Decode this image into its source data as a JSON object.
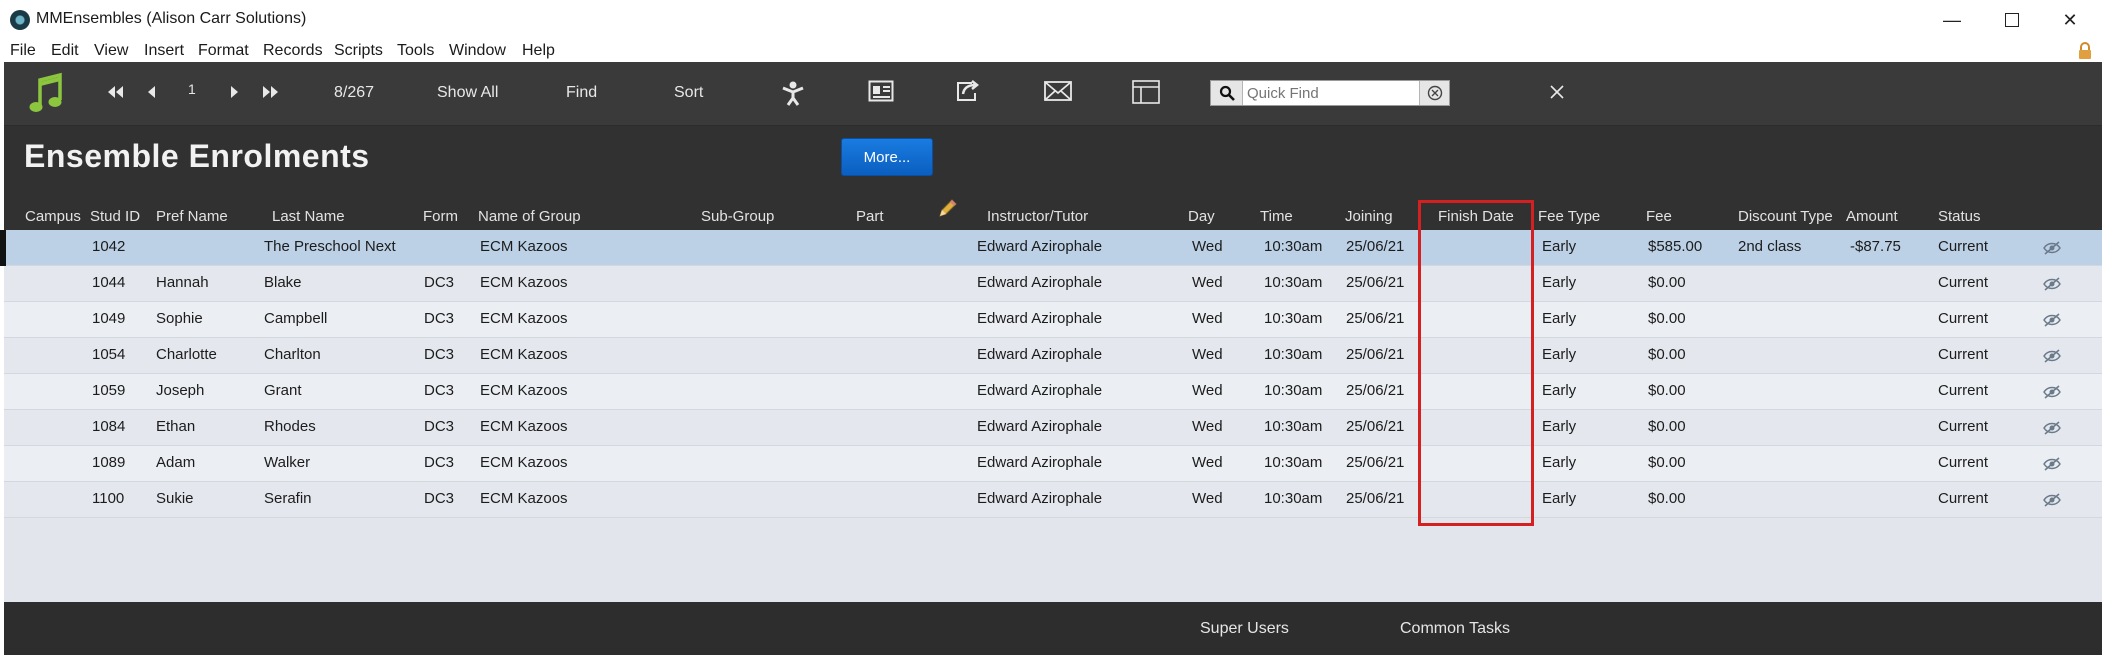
{
  "window": {
    "title": "MMEnsembles (Alison Carr Solutions)"
  },
  "menu": [
    "File",
    "Edit",
    "View",
    "Insert",
    "Format",
    "Records",
    "Scripts",
    "Tools",
    "Window",
    "Help"
  ],
  "toolbar": {
    "record_number": "1",
    "record_count": "8/267",
    "show_all": "Show All",
    "find": "Find",
    "sort": "Sort",
    "quick_find_placeholder": "Quick Find"
  },
  "page": {
    "title": "Ensemble Enrolments",
    "more_button": "More..."
  },
  "columns": {
    "campus": "Campus",
    "stud_id": "Stud ID",
    "pref_name": "Pref Name",
    "last_name": "Last Name",
    "form": "Form",
    "group": "Name of Group",
    "subgroup": "Sub-Group",
    "part": "Part",
    "instructor": "Instructor/Tutor",
    "day": "Day",
    "time": "Time",
    "joining": "Joining",
    "finish": "Finish Date",
    "fee_type": "Fee Type",
    "fee": "Fee",
    "discount": "Discount Type",
    "amount": "Amount",
    "status": "Status"
  },
  "rows": [
    {
      "id": "1042",
      "pref": "",
      "last": "The Preschool Next",
      "form": "",
      "group": "ECM Kazoos",
      "instructor": "Edward Azirophale",
      "day": "Wed",
      "time": "10:30am",
      "joining": "25/06/21",
      "fee_type": "Early",
      "fee": "$585.00",
      "discount": "2nd class",
      "amount": "-$87.75",
      "status": "Current"
    },
    {
      "id": "1044",
      "pref": "Hannah",
      "last": "Blake",
      "form": "DC3",
      "group": "ECM Kazoos",
      "instructor": "Edward Azirophale",
      "day": "Wed",
      "time": "10:30am",
      "joining": "25/06/21",
      "fee_type": "Early",
      "fee": "$0.00",
      "discount": "",
      "amount": "",
      "status": "Current"
    },
    {
      "id": "1049",
      "pref": "Sophie",
      "last": "Campbell",
      "form": "DC3",
      "group": "ECM Kazoos",
      "instructor": "Edward Azirophale",
      "day": "Wed",
      "time": "10:30am",
      "joining": "25/06/21",
      "fee_type": "Early",
      "fee": "$0.00",
      "discount": "",
      "amount": "",
      "status": "Current"
    },
    {
      "id": "1054",
      "pref": "Charlotte",
      "last": "Charlton",
      "form": "DC3",
      "group": "ECM Kazoos",
      "instructor": "Edward Azirophale",
      "day": "Wed",
      "time": "10:30am",
      "joining": "25/06/21",
      "fee_type": "Early",
      "fee": "$0.00",
      "discount": "",
      "amount": "",
      "status": "Current"
    },
    {
      "id": "1059",
      "pref": "Joseph",
      "last": "Grant",
      "form": "DC3",
      "group": "ECM Kazoos",
      "instructor": "Edward Azirophale",
      "day": "Wed",
      "time": "10:30am",
      "joining": "25/06/21",
      "fee_type": "Early",
      "fee": "$0.00",
      "discount": "",
      "amount": "",
      "status": "Current"
    },
    {
      "id": "1084",
      "pref": "Ethan",
      "last": "Rhodes",
      "form": "DC3",
      "group": "ECM Kazoos",
      "instructor": "Edward Azirophale",
      "day": "Wed",
      "time": "10:30am",
      "joining": "25/06/21",
      "fee_type": "Early",
      "fee": "$0.00",
      "discount": "",
      "amount": "",
      "status": "Current"
    },
    {
      "id": "1089",
      "pref": "Adam",
      "last": "Walker",
      "form": "DC3",
      "group": "ECM Kazoos",
      "instructor": "Edward Azirophale",
      "day": "Wed",
      "time": "10:30am",
      "joining": "25/06/21",
      "fee_type": "Early",
      "fee": "$0.00",
      "discount": "",
      "amount": "",
      "status": "Current"
    },
    {
      "id": "1100",
      "pref": "Sukie",
      "last": "Serafin",
      "form": "DC3",
      "group": "ECM Kazoos",
      "instructor": "Edward Azirophale",
      "day": "Wed",
      "time": "10:30am",
      "joining": "25/06/21",
      "fee_type": "Early",
      "fee": "$0.00",
      "discount": "",
      "amount": "",
      "status": "Current"
    }
  ],
  "footer": {
    "super_users": "Super Users",
    "common_tasks": "Common Tasks"
  },
  "colors": {
    "toolbar_bg": "#3a3a3a",
    "header_bg": "#313131",
    "selected_row": "#bcd0e6",
    "accent_blue": "#0a6fd6",
    "highlight_red": "#d42020",
    "logo_green": "#8cc63f"
  }
}
